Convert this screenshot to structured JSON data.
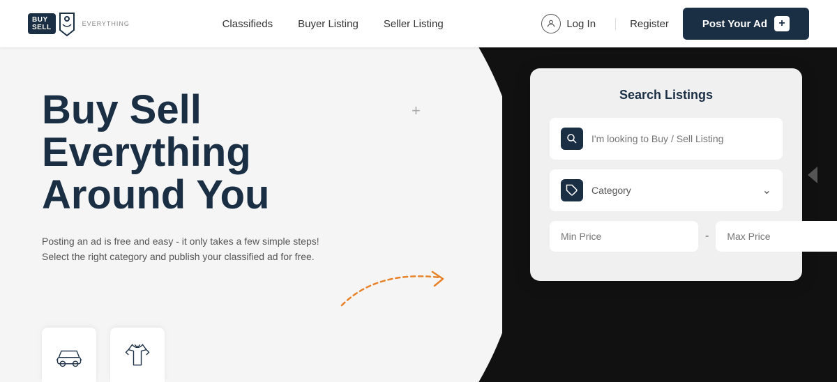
{
  "logo": {
    "line1": "BUY",
    "line2": "SELL",
    "tagline": "EVERYTHING"
  },
  "nav": {
    "links": [
      {
        "label": "Classifieds",
        "name": "classifieds"
      },
      {
        "label": "Buyer Listing",
        "name": "buyer-listing"
      },
      {
        "label": "Seller Listing",
        "name": "seller-listing"
      }
    ],
    "login_label": "Log In",
    "register_label": "Register",
    "post_ad_label": "Post Your Ad",
    "post_ad_plus": "+"
  },
  "hero": {
    "title_line1": "Buy Sell",
    "title_line2": "Everything",
    "title_line3": "Around You",
    "subtitle1": "Posting an ad is free and easy - it only takes a few simple steps!",
    "subtitle2": "Select the right category and publish your classified ad for free."
  },
  "search": {
    "title": "Search Listings",
    "keyword_placeholder": "I'm looking to Buy / Sell Listing",
    "category_placeholder": "Category",
    "min_price_placeholder": "Min Price",
    "max_price_placeholder": "Max Price"
  }
}
